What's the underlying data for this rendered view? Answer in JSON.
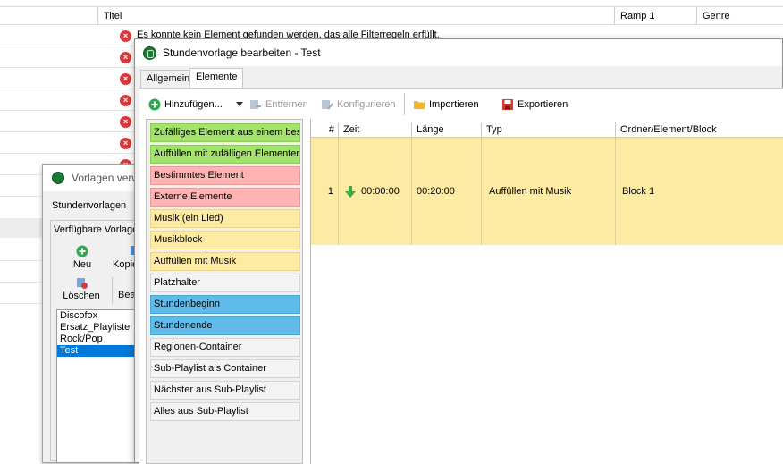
{
  "background_window": {
    "columns": [
      "Titel",
      "Ramp 1",
      "Genre"
    ],
    "error_message": "Es konnte kein Element gefunden werden, das alle Filterregeln erfüllt."
  },
  "left_dialog": {
    "title": "Vorlagen verwalten",
    "section_label": "Stundenvorlagen",
    "group_label": "Verfügbare Vorlagen",
    "buttons": {
      "new": "Neu",
      "copy": "Kopieren",
      "delete": "Löschen",
      "edit": "Bearbeiten"
    },
    "templates": [
      "Discofox",
      "Ersatz_Playliste",
      "Rock/Pop",
      "Test"
    ],
    "selected_template": "Test"
  },
  "main_dialog": {
    "title": "Stundenvorlage bearbeiten - Test",
    "tabs": [
      "Allgemein",
      "Elemente"
    ],
    "active_tab": "Elemente",
    "toolbar": {
      "add": "Hinzufügen...",
      "remove": "Entfernen",
      "configure": "Konfigurieren",
      "import": "Importieren",
      "export": "Exportieren"
    },
    "element_types": [
      {
        "label": "Zufälliges Element aus einem bestimmten Ordner",
        "color": "green"
      },
      {
        "label": "Auffüllen mit zufälligen Elementen",
        "color": "green"
      },
      {
        "label": "Bestimmtes Element",
        "color": "red"
      },
      {
        "label": "Externe Elemente",
        "color": "red"
      },
      {
        "label": "Musik (ein Lied)",
        "color": "yellow"
      },
      {
        "label": "Musikblock",
        "color": "yellow"
      },
      {
        "label": "Auffüllen mit Musik",
        "color": "yellow"
      },
      {
        "label": "Platzhalter",
        "color": "gray"
      },
      {
        "label": "Stundenbeginn",
        "color": "blue"
      },
      {
        "label": "Stundenende",
        "color": "blue"
      },
      {
        "label": "Regionen-Container",
        "color": "gray"
      },
      {
        "label": "Sub-Playlist als Container",
        "color": "gray"
      },
      {
        "label": "Nächster aus Sub-Playlist",
        "color": "gray"
      },
      {
        "label": "Alles aus Sub-Playlist",
        "color": "gray"
      }
    ],
    "grid": {
      "headers": [
        "#",
        "Zeit",
        "Länge",
        "Typ",
        "Ordner/Element/Block"
      ],
      "rows": [
        {
          "num": "1",
          "time": "00:00:00",
          "length": "00:20:00",
          "type": "Auffüllen mit Musik",
          "folder": "Block 1"
        }
      ]
    }
  },
  "colors": {
    "green": "#a3e26b",
    "red": "#ffb3b3",
    "yellow": "#fdeba4",
    "blue": "#5fbcea",
    "selection": "#0078d7"
  }
}
